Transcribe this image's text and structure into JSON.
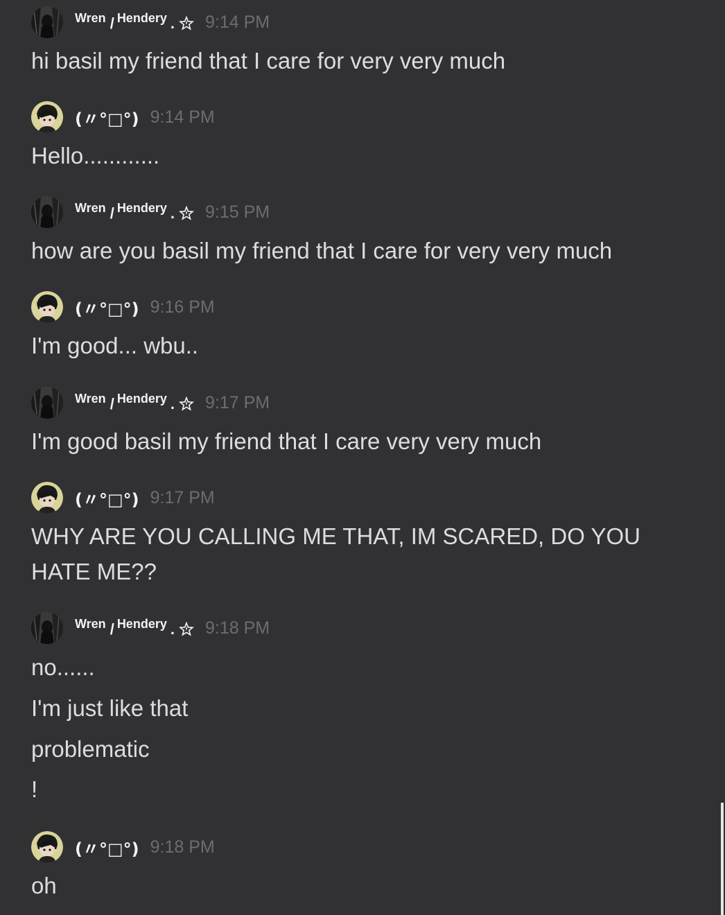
{
  "users": {
    "wren": {
      "name_a": "Wren",
      "name_b": "Hendery",
      "slash": "/",
      "dot": "."
    },
    "basil": {
      "name": "(〃°□°)"
    }
  },
  "messages": [
    {
      "user": "wren",
      "time": "9:14 PM",
      "lines": [
        "hi basil my friend that I care for very very much"
      ]
    },
    {
      "user": "basil",
      "time": "9:14 PM",
      "lines": [
        "Hello............"
      ]
    },
    {
      "user": "wren",
      "time": "9:15 PM",
      "lines": [
        "how are you basil my friend that I care for very very much"
      ]
    },
    {
      "user": "basil",
      "time": "9:16 PM",
      "lines": [
        "I'm good... wbu.."
      ]
    },
    {
      "user": "wren",
      "time": "9:17 PM",
      "lines": [
        "I'm good basil my friend that I care very very much"
      ]
    },
    {
      "user": "basil",
      "time": "9:17 PM",
      "lines": [
        "WHY ARE YOU CALLING ME THAT, IM SCARED, DO YOU",
        "HATE ME??"
      ]
    },
    {
      "user": "wren",
      "time": "9:18 PM",
      "lines": [
        "no......",
        "I'm just like that",
        "problematic",
        "!"
      ]
    },
    {
      "user": "basil",
      "time": "9:18 PM",
      "lines": [
        "oh"
      ]
    }
  ],
  "icons": {
    "badge": "star-icon"
  },
  "colors": {
    "background": "#313133",
    "timestamp": "#6b6d70",
    "text": "#dcddde"
  }
}
